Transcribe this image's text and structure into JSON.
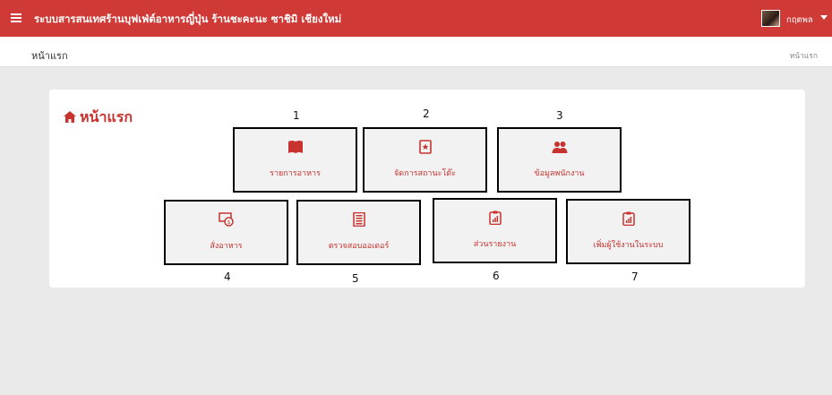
{
  "header": {
    "title": "ระบบสารสนเทศร้านบุฟเฟ่ต์อาหารญี่ปุ่น ร้านชะคะนะ ซาชิมิ เชียงใหม่",
    "username": "กฤตพล",
    "accent_color": "#cf3a36"
  },
  "subheader": {
    "page_title": "หน้าแรก",
    "breadcrumb": "หน้าแรก"
  },
  "panel": {
    "title": "หน้าแรก",
    "title_icon": "home-icon"
  },
  "tiles": [
    {
      "number": "1",
      "label": "รายการอาหาร",
      "icon": "book-icon"
    },
    {
      "number": "2",
      "label": "จัดการสถานะโต๊ะ",
      "icon": "bookmark-icon"
    },
    {
      "number": "3",
      "label": "ข้อมูลพนักงาน",
      "icon": "users-icon"
    },
    {
      "number": "4",
      "label": "สั่งอาหาร",
      "icon": "money-icon"
    },
    {
      "number": "5",
      "label": "ตรวจสอบออเดอร์",
      "icon": "list-icon"
    },
    {
      "number": "6",
      "label": "ส่วนรายงาน",
      "icon": "report-icon"
    },
    {
      "number": "7",
      "label": "เพิ่มผู้ใช้งานในระบบ",
      "icon": "report-icon"
    }
  ]
}
